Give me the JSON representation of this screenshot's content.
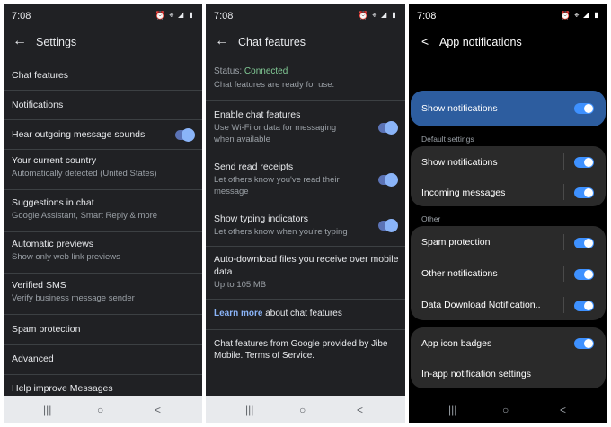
{
  "panel1": {
    "time": "7:08",
    "title": "Settings",
    "items": [
      {
        "title": "Chat features"
      },
      {
        "title": "Notifications"
      },
      {
        "title": "Hear outgoing message sounds",
        "toggle": true
      },
      {
        "title": "Your current country",
        "subtitle": "Automatically detected (United States)"
      },
      {
        "title": "Suggestions in chat",
        "subtitle": "Google Assistant, Smart Reply & more"
      },
      {
        "title": "Automatic previews",
        "subtitle": "Show only web link previews"
      },
      {
        "title": "Verified SMS",
        "subtitle": "Verify business message sender"
      },
      {
        "title": "Spam protection"
      },
      {
        "title": "Advanced"
      },
      {
        "title": "Help improve Messages"
      }
    ]
  },
  "panel2": {
    "time": "7:08",
    "title": "Chat features",
    "status_label": "Status:",
    "status_value": "Connected",
    "status_sub": "Chat features are ready for use.",
    "items": [
      {
        "title": "Enable chat features",
        "subtitle1": "Use Wi-Fi or data for messaging",
        "subtitle2": "when available",
        "toggle": true
      },
      {
        "title": "Send read receipts",
        "subtitle1": "Let others know you've read their",
        "subtitle2": "message",
        "toggle": true
      },
      {
        "title": "Show typing indicators",
        "subtitle1": "Let others know when you're typing",
        "toggle": true
      },
      {
        "title1": "Auto-download files you receive over mobile",
        "title2": "data",
        "subtitle": "Up to 105 MB"
      }
    ],
    "learn_more_link": "Learn more",
    "learn_more_rest": " about chat features",
    "footer1": "Chat features from Google provided by Jibe",
    "footer2": "Mobile. Terms of Service."
  },
  "panel3": {
    "time": "7:08",
    "title": "App notifications",
    "show_notifications_main": "Show notifications",
    "header_default": "Default settings",
    "default_rows": [
      "Show notifications",
      "Incoming messages"
    ],
    "header_other": "Other",
    "other_rows": [
      "Spam protection",
      "Other notifications",
      "Data Download Notification.."
    ],
    "last_rows": [
      "App icon badges",
      "In-app notification settings"
    ]
  },
  "colors": {
    "accent": "#8ab4f8",
    "connected": "#81c995",
    "samsung_toggle": "#3e91ff",
    "highlight": "#2d5d9f"
  }
}
